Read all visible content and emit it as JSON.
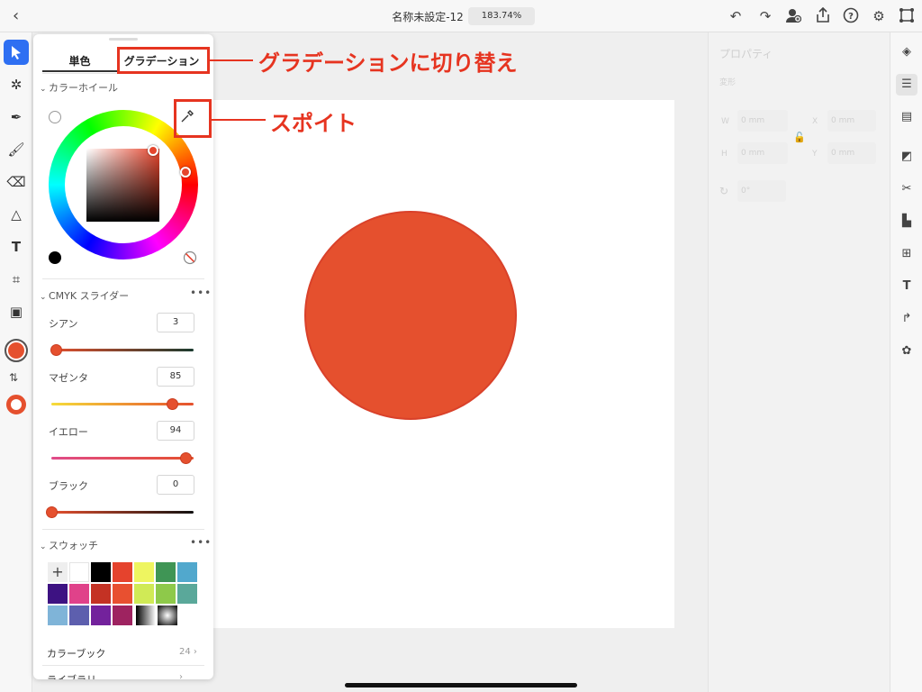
{
  "topbar": {
    "back_icon": "chevron-left-icon",
    "title": "名称未設定-12",
    "zoom": "183.74%",
    "icons": [
      "undo-icon",
      "redo-icon",
      "share-user-icon",
      "export-icon",
      "help-icon",
      "settings-icon",
      "fullscreen-icon"
    ]
  },
  "toolbar": {
    "tools": [
      "select-icon",
      "direct-select-icon",
      "pen-icon",
      "brush-icon",
      "eraser-icon",
      "shape-icon",
      "type-icon",
      "artboard-icon",
      "image-icon"
    ],
    "fill_color": "#e5502e",
    "swap_icon": "swap-icon"
  },
  "color_panel": {
    "tabs": [
      "単色",
      "グラデーション"
    ],
    "wheel_section": "カラーホイール",
    "cmyk_section": "CMYK スライダー",
    "sliders": [
      {
        "label": "シアン",
        "value": "3",
        "fraction": 0.03
      },
      {
        "label": "マゼンタ",
        "value": "85",
        "fraction": 0.85
      },
      {
        "label": "イエロー",
        "value": "94",
        "fraction": 0.94
      },
      {
        "label": "ブラック",
        "value": "0",
        "fraction": 0.0
      }
    ],
    "swatches_section": "スウォッチ",
    "add_label": "+",
    "swatches": [
      "#ffffff",
      "#000000",
      "#e5432d",
      "#eef560",
      "#3f9555",
      "#51a8cd",
      "#3d1282",
      "#e0428a",
      "#c43224",
      "#e85030",
      "#d0ea56",
      "#8ec94a",
      "#5aa89a",
      "#7fb4d8",
      "#5d5fae",
      "#73229c",
      "#9e2360"
    ],
    "color_book_label": "カラーブック",
    "color_book_count": "24",
    "library_label": "ライブラリ"
  },
  "properties": {
    "title": "プロパティ",
    "transform": "変形",
    "w_label": "W",
    "w_value": "0 mm",
    "h_label": "H",
    "h_value": "0 mm",
    "x_label": "X",
    "x_value": "0 mm",
    "y_label": "Y",
    "y_value": "0 mm",
    "rotation": "0°"
  },
  "rightbar": {
    "icons": [
      "layers-icon",
      "properties-icon",
      "brush-library-icon",
      "pathfinder-icon",
      "scissors-icon",
      "align-icon",
      "repeat-grid-icon",
      "type-settings-icon",
      "path-icon",
      "component-icon"
    ]
  },
  "callouts": {
    "gradient": "グラデーションに切り替え",
    "eyedropper": "スポイト"
  },
  "colors": {
    "accent": "#e5502e",
    "callout": "#e63420",
    "selected_tool": "#2e6ff2"
  }
}
